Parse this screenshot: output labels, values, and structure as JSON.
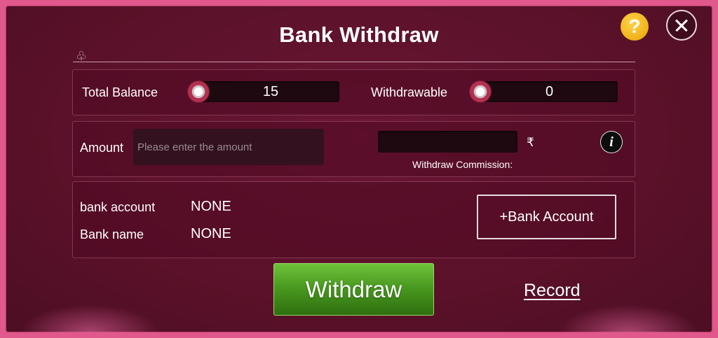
{
  "dialog": {
    "title": "Bank Withdraw",
    "help_icon": "question-icon",
    "help_glyph": "?",
    "close_icon": "close-icon",
    "decor_icon": "club-icon",
    "decor_glyph": "♧"
  },
  "balance": {
    "total_label": "Total Balance",
    "total_value": "15",
    "withdrawable_label": "Withdrawable",
    "withdrawable_value": "0",
    "coin_icon": "chip-icon"
  },
  "amount": {
    "label": "Amount",
    "placeholder": "Please enter the amount",
    "currency_symbol": "₹",
    "commission_label": "Withdraw Commission:",
    "info_glyph": "i"
  },
  "bank": {
    "account_label": "bank account",
    "account_value": "NONE",
    "name_label": "Bank name",
    "name_value": "NONE",
    "add_button": "+Bank Account"
  },
  "actions": {
    "withdraw": "Withdraw",
    "record": "Record"
  },
  "colors": {
    "accent_green": "#4a9a20",
    "dialog_bg": "#5a1129",
    "frame_pink": "#e0588c",
    "help_yellow": "#f0b400"
  }
}
